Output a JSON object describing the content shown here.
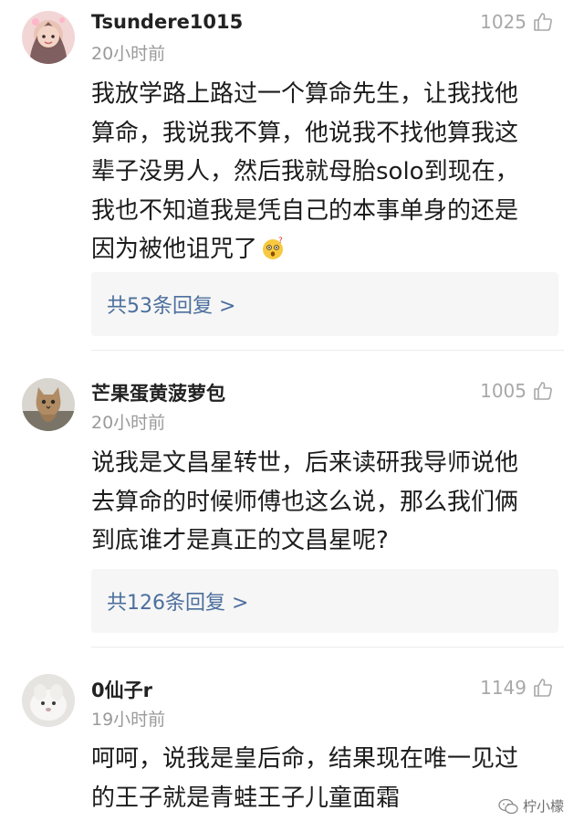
{
  "comments": [
    {
      "username": "Tsundere1015",
      "time": "20小时前",
      "likes": "1025",
      "body_lines": [
        "我放学路上路过一个算命先生，让我找他",
        "算命，我说我不算，他说我不找他算我这",
        "辈子没男人，然后我就母胎solo到现在，",
        "我也不知道我是凭自己的本事单身的还是",
        "因为被他诅咒了"
      ],
      "emoji": "astonished-face",
      "replies_label": "共53条回复 >"
    },
    {
      "username": "芒果蛋黄菠萝包",
      "time": "20小时前",
      "likes": "1005",
      "body_lines": [
        "说我是文昌星转世，后来读研我导师说他",
        "去算命的时候师傅也这么说，那么我们俩",
        "到底谁才是真正的文昌星呢?"
      ],
      "replies_label": "共126条回复 >"
    },
    {
      "username": "0仙子r",
      "time": "19小时前",
      "likes": "1149",
      "body_lines": [
        "呵呵，说我是皇后命，结果现在唯一见过",
        "的王子就是青蛙王子儿童面霜"
      ]
    }
  ],
  "watermark": "柠小檬",
  "icons": {
    "like": "thumbs-up-outline-icon",
    "watermark": "wechat-icon"
  },
  "colors": {
    "reply_link": "#4c6f9d",
    "muted": "#9a9a9a",
    "reply_bg": "#f6f6f6"
  }
}
